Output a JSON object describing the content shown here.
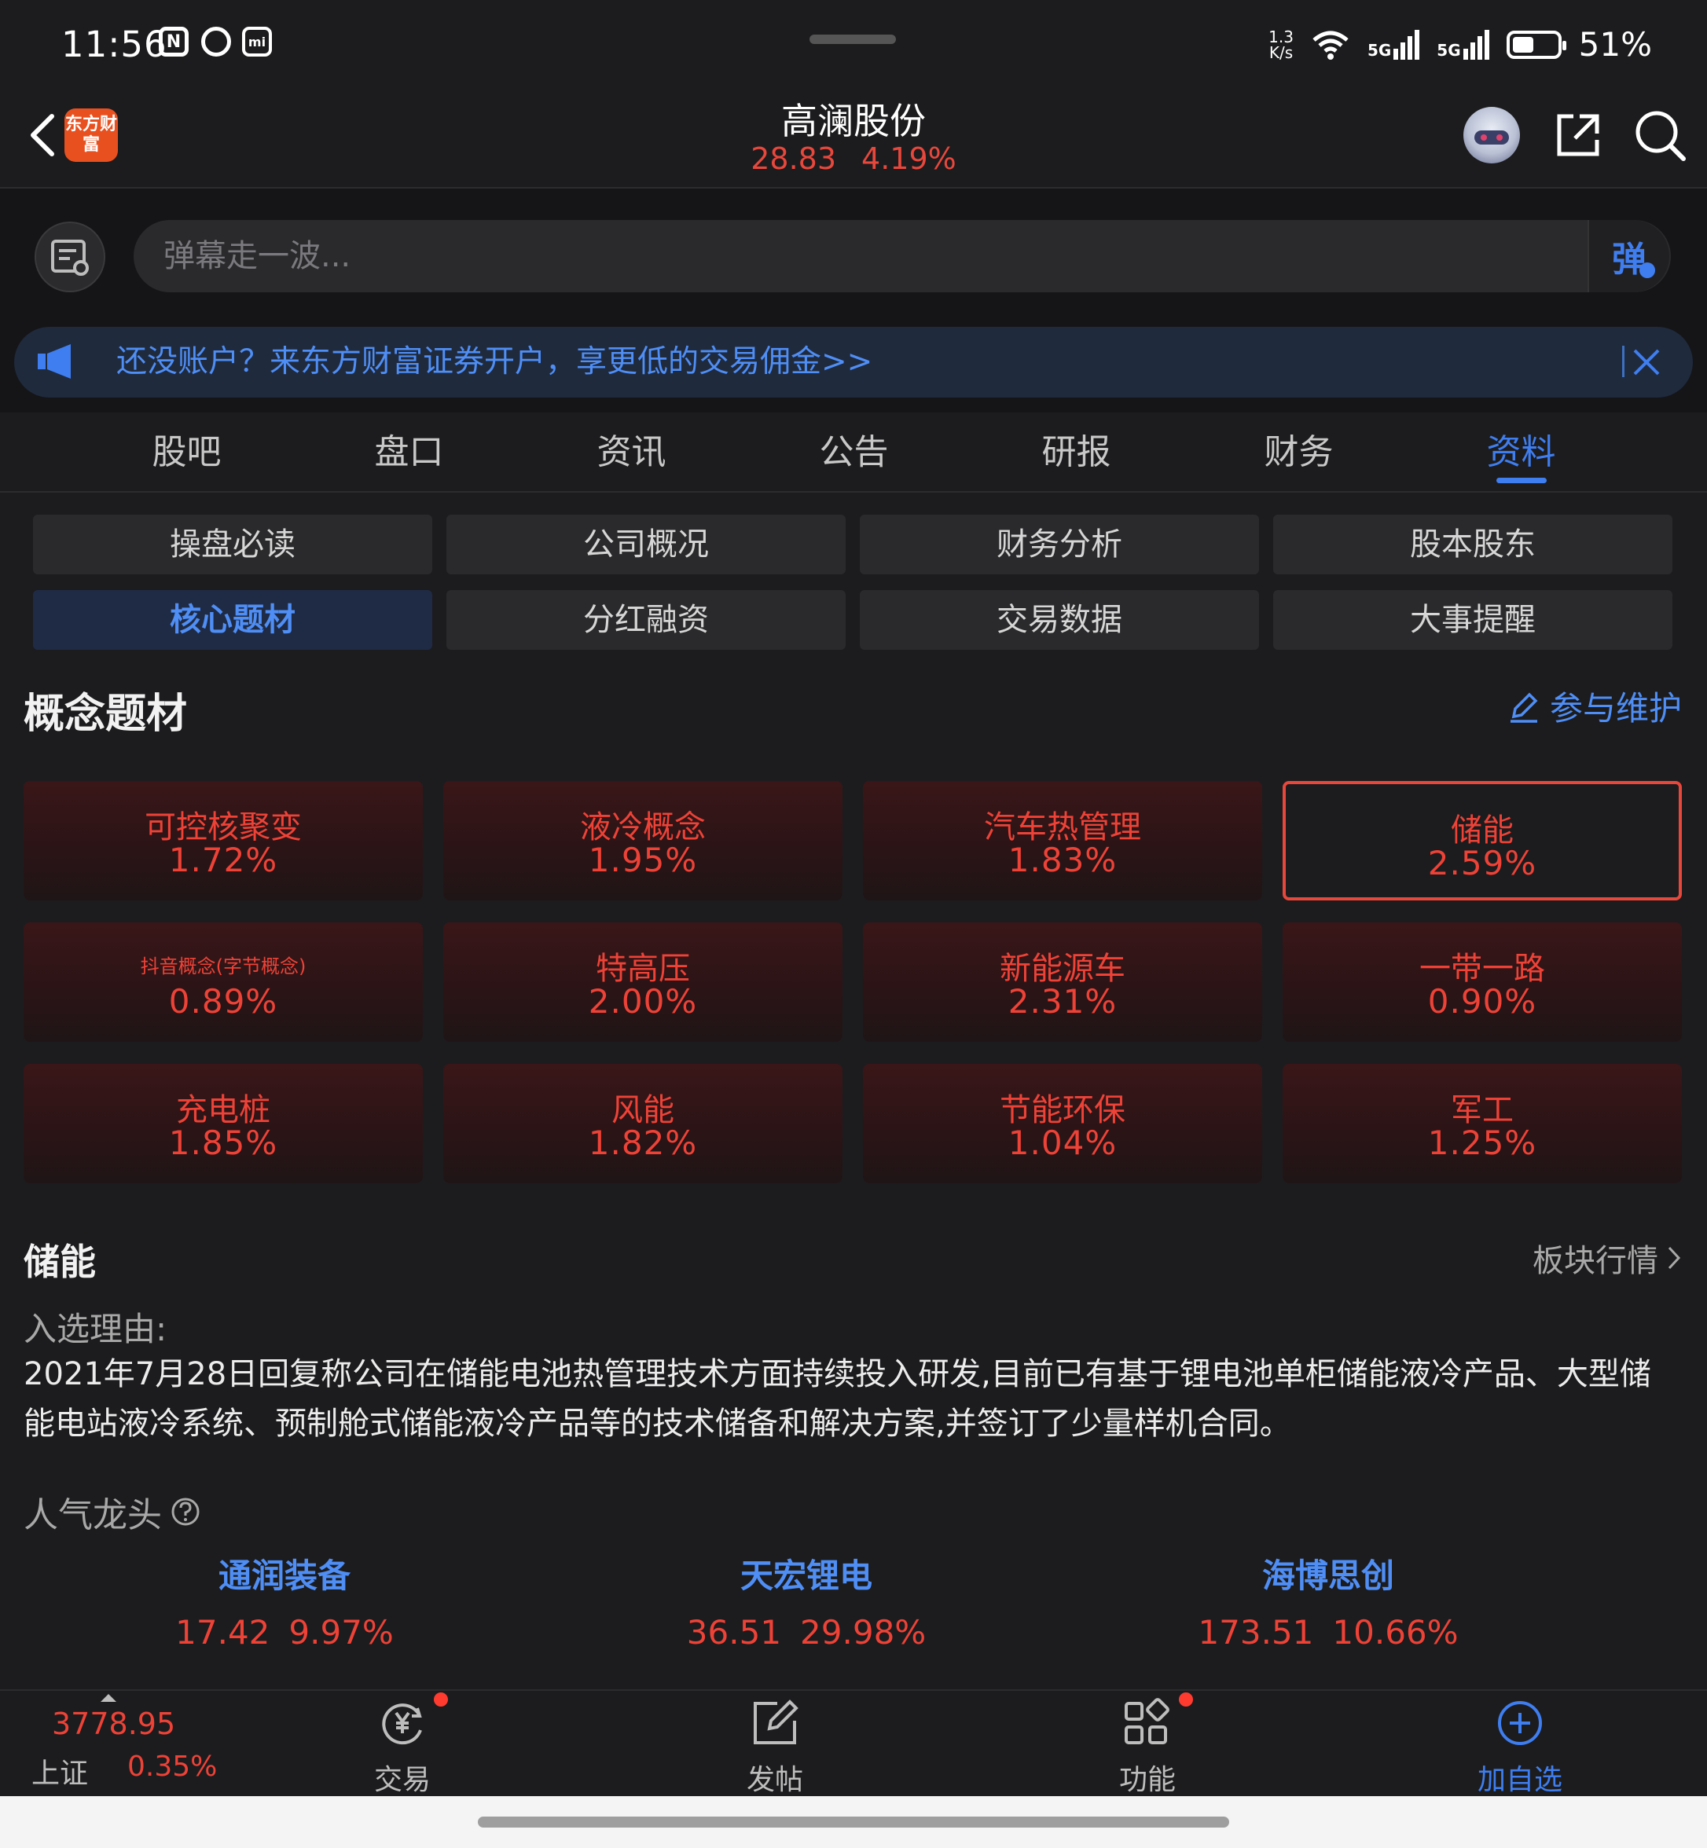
{
  "status": {
    "time": "11:56",
    "net_speed": "1.3\nK/s",
    "signal1": "5G",
    "signal2": "5G",
    "battery": "51%"
  },
  "header": {
    "title": "高澜股份",
    "price": "28.83",
    "change_pct": "4.19%",
    "logo_text": "东方财富"
  },
  "danmu": {
    "placeholder": "弹幕走一波...",
    "send_label": "弹"
  },
  "banner": {
    "text": "还没账户？来东方财富证券开户，享更低的交易佣金>>"
  },
  "tabs": [
    "股吧",
    "盘口",
    "资讯",
    "公告",
    "研报",
    "财务",
    "资料"
  ],
  "active_tab": "资料",
  "subtabs": [
    "操盘必读",
    "公司概况",
    "财务分析",
    "股本股东",
    "核心题材",
    "分红融资",
    "交易数据",
    "大事提醒"
  ],
  "active_subtab": "核心题材",
  "concepts": {
    "title": "概念题材",
    "maintain_label": "参与维护",
    "items": [
      {
        "name": "可控核聚变",
        "pct": "1.72%"
      },
      {
        "name": "液冷概念",
        "pct": "1.95%"
      },
      {
        "name": "汽车热管理",
        "pct": "1.83%"
      },
      {
        "name": "储能",
        "pct": "2.59%"
      },
      {
        "name": "抖音概念(字节概念)",
        "pct": "0.89%"
      },
      {
        "name": "特高压",
        "pct": "2.00%"
      },
      {
        "name": "新能源车",
        "pct": "2.31%"
      },
      {
        "name": "一带一路",
        "pct": "0.90%"
      },
      {
        "name": "充电桩",
        "pct": "1.85%"
      },
      {
        "name": "风能",
        "pct": "1.82%"
      },
      {
        "name": "节能环保",
        "pct": "1.04%"
      },
      {
        "name": "军工",
        "pct": "1.25%"
      }
    ],
    "selected_index": 3
  },
  "detail": {
    "title": "储能",
    "more_label": "板块行情",
    "reason_label": "入选理由:",
    "reason": "2021年7月28日回复称公司在储能电池热管理技术方面持续投入研发,目前已有基于锂电池单柜储能液冷产品、大型储能电站液冷系统、预制舱式储能液冷产品等的技术储备和解决方案,并签订了少量样机合同。",
    "popular_label": "人气龙头",
    "leaders": [
      {
        "name": "通润装备",
        "price": "17.42",
        "pct": "9.97%"
      },
      {
        "name": "天宏锂电",
        "price": "36.51",
        "pct": "29.98%"
      },
      {
        "name": "海博思创",
        "price": "173.51",
        "pct": "10.66%"
      }
    ]
  },
  "bottom": {
    "index_value": "3778.95",
    "index_name": "上证",
    "index_pct": "0.35%",
    "items": [
      {
        "label": "交易",
        "icon": "yen-trade-icon"
      },
      {
        "label": "发帖",
        "icon": "edit-post-icon"
      },
      {
        "label": "功能",
        "icon": "grid-function-icon"
      },
      {
        "label": "加自选",
        "icon": "plus-circle-icon"
      }
    ]
  },
  "colors": {
    "accent": "#3f7ef0",
    "up": "#ee4237",
    "bg": "#1c1c1e"
  }
}
